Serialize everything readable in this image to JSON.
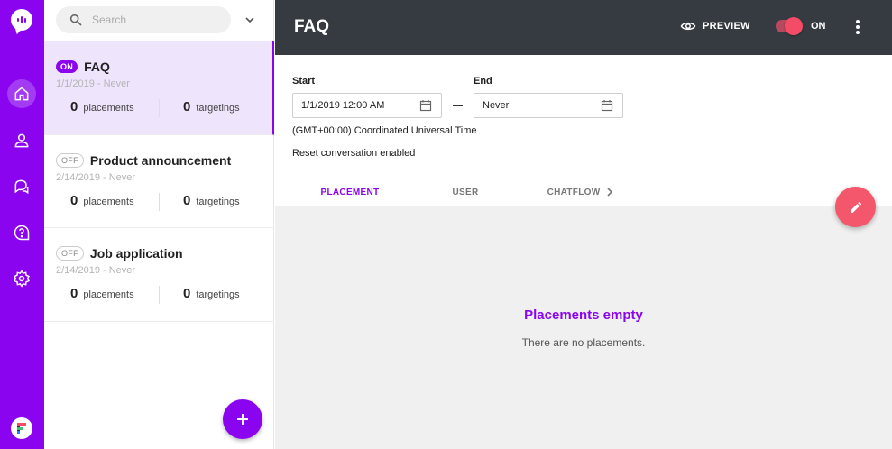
{
  "rail": {
    "items": [
      {
        "icon": "home-icon",
        "active": true
      },
      {
        "icon": "user-icon",
        "active": false
      },
      {
        "icon": "chat-bubbles-icon",
        "active": false
      },
      {
        "icon": "help-icon",
        "active": false
      },
      {
        "icon": "gear-icon",
        "active": false
      }
    ]
  },
  "search": {
    "placeholder": "Search"
  },
  "conversations": [
    {
      "status": "ON",
      "title": "FAQ",
      "dates": "1/1/2019 - Never",
      "placements": "0",
      "placements_label": "placements",
      "targetings": "0",
      "targetings_label": "targetings"
    },
    {
      "status": "OFF",
      "title": "Product announcement",
      "dates": "2/14/2019 - Never",
      "placements": "0",
      "placements_label": "placements",
      "targetings": "0",
      "targetings_label": "targetings"
    },
    {
      "status": "OFF",
      "title": "Job application",
      "dates": "2/14/2019 - Never",
      "placements": "0",
      "placements_label": "placements",
      "targetings": "0",
      "targetings_label": "targetings"
    }
  ],
  "header": {
    "title": "FAQ",
    "preview_label": "PREVIEW",
    "toggle_label": "ON"
  },
  "schedule": {
    "start_label": "Start",
    "start_value": "1/1/2019 12:00 AM",
    "end_label": "End",
    "end_value": "Never",
    "timezone": "(GMT+00:00) Coordinated Universal Time",
    "reset_note": "Reset conversation enabled"
  },
  "tabs": [
    {
      "label": "PLACEMENT",
      "active": true
    },
    {
      "label": "USER",
      "active": false
    },
    {
      "label": "CHATFLOW",
      "active": false
    }
  ],
  "empty_state": {
    "title": "Placements empty",
    "text": "There are no placements."
  },
  "colors": {
    "accent": "#8a04f0",
    "header": "#353b40",
    "fab_edit": "#f4566c",
    "toggle_on": "#f44b67"
  }
}
